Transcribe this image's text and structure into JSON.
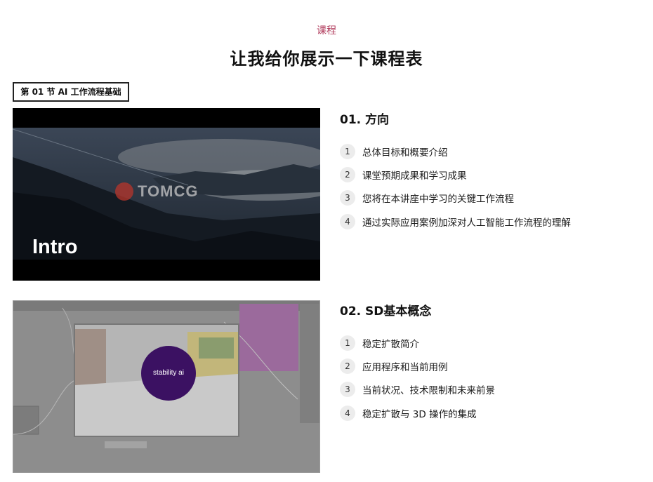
{
  "header": {
    "eyebrow": "课程",
    "title": "让我给你展示一下课程表"
  },
  "section": {
    "label": "第 01 节 AI 工作流程基础"
  },
  "colors": {
    "accent": "#b03a5b",
    "stability_logo": "#3b1162"
  },
  "lessons": [
    {
      "title": "01. 方向",
      "thumbnail": {
        "overlay_text": "Intro",
        "watermark": "TOMCG"
      },
      "items": [
        {
          "num": "1",
          "text": "总体目标和概要介绍"
        },
        {
          "num": "2",
          "text": "课堂预期成果和学习成果"
        },
        {
          "num": "3",
          "text": "您将在本讲座中学习的关键工作流程"
        },
        {
          "num": "4",
          "text": "通过实际应用案例加深对人工智能工作流程的理解"
        }
      ]
    },
    {
      "title": "02. SD基本概念",
      "thumbnail": {
        "logo_text": "stability ai"
      },
      "items": [
        {
          "num": "1",
          "text": "稳定扩散简介"
        },
        {
          "num": "2",
          "text": "应用程序和当前用例"
        },
        {
          "num": "3",
          "text": "当前状况、技术限制和未来前景"
        },
        {
          "num": "4",
          "text": "稳定扩散与 3D 操作的集成"
        }
      ]
    }
  ]
}
